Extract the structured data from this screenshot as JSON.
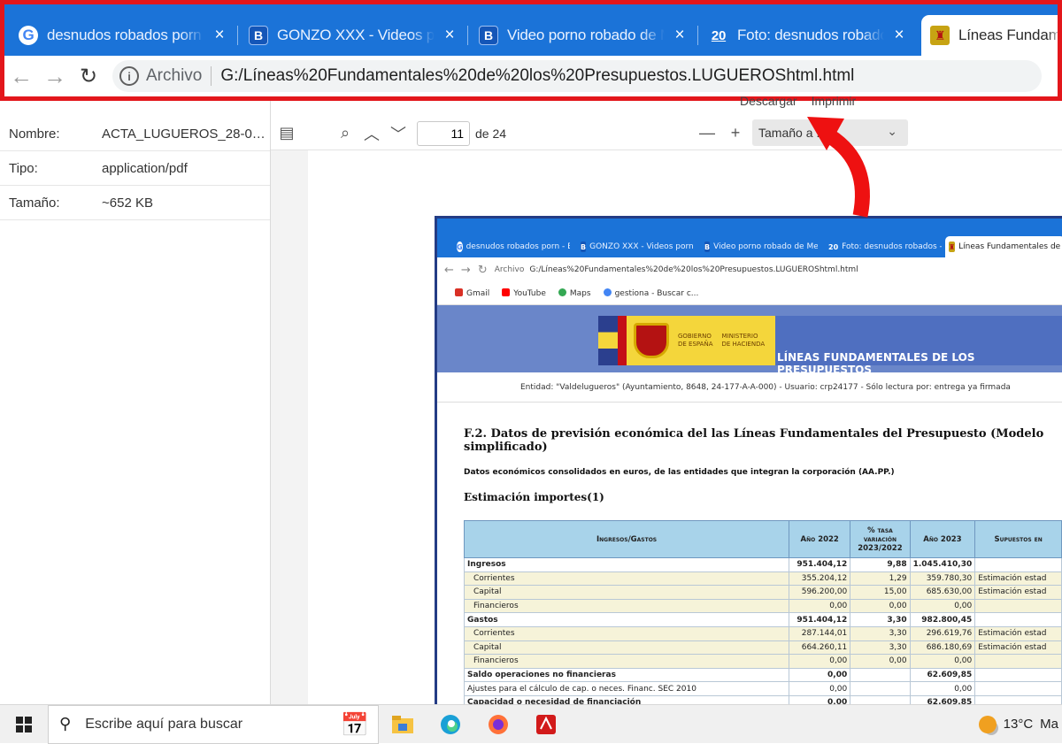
{
  "browser": {
    "tabs": [
      {
        "title": "desnudos robados porn - Bú",
        "icon": "google-icon"
      },
      {
        "title": "GONZO XXX - Videos porno",
        "icon": "b-site-icon"
      },
      {
        "title": "Video porno robado de Meg",
        "icon": "b-site-icon"
      },
      {
        "title": "Foto: desnudos robados - el",
        "icon": "20-site-icon"
      },
      {
        "title": "Líneas Fundamentales de los",
        "icon": "spain-gov-icon"
      }
    ],
    "close_glyph": "×",
    "address": {
      "label": "Archivo",
      "url": "G:/Líneas%20Fundamentales%20de%20los%20Presupuestos.LUGUEROShtml.html"
    },
    "outline_color": "#e3161b"
  },
  "side_panel": {
    "rows": [
      {
        "key": "Nombre:",
        "value": "ACTA_LUGUEROS_28-09-..."
      },
      {
        "key": "Tipo:",
        "value": "application/pdf"
      },
      {
        "key": "Tamaño:",
        "value": "~652 KB"
      }
    ]
  },
  "actions": {
    "download": "Descargar",
    "print": "Imprimir"
  },
  "pdf_toolbar": {
    "page": "11",
    "of_pages": "de 24",
    "zoom": "Tamaño a  ...  o"
  },
  "embedded": {
    "tabs": [
      "desnudos robados porn - Bú",
      "GONZO XXX - Videos porno",
      "Video porno robado de Meg",
      "Foto: desnudos robados - el",
      "Líneas Fundamentales de los"
    ],
    "url_label": "Archivo",
    "url": "G:/Líneas%20Fundamentales%20de%20los%20Presupuestos.LUGUEROShtml.html",
    "bookmarks": [
      "Gmail",
      "YouTube",
      "Maps",
      "gestiona - Buscar c..."
    ],
    "gov_text": "GOBIERNO\nDE ESPAÑA",
    "ministry_text": "MINISTERIO\nDE HACIENDA",
    "banner_title": "LÍNEAS FUNDAMENTALES DE LOS PRESUPUESTOS",
    "entidad": "Entidad: \"Valdelugueros\" (Ayuntamiento, 8648, 24-177-A-A-000) - Usuario: crp24177 - Sólo lectura por: entrega ya firmada",
    "heading": "F.2. Datos de previsión económica del las Líneas Fundamentales del Presupuesto (Modelo simplificado)",
    "subheading": "Datos económicos consolidados en euros, de las entidades que integran la corporación (AA.PP.)",
    "section": "Estimación importes(1)",
    "table": {
      "headers": [
        "Ingresos/Gastos",
        "Año 2022",
        "% tasa variación 2023/2022",
        "Año 2023",
        "Supuestos en"
      ],
      "rows": [
        {
          "type": "main",
          "cells": [
            "Ingresos",
            "951.404,12",
            "9,88",
            "1.045.410,30",
            ""
          ]
        },
        {
          "type": "sub",
          "cells": [
            "Corrientes",
            "355.204,12",
            "1,29",
            "359.780,30",
            "Estimación estad"
          ]
        },
        {
          "type": "sub",
          "cells": [
            "Capital",
            "596.200,00",
            "15,00",
            "685.630,00",
            "Estimación estad"
          ]
        },
        {
          "type": "sub",
          "cells": [
            "Financieros",
            "0,00",
            "0,00",
            "0,00",
            ""
          ]
        },
        {
          "type": "main",
          "cells": [
            "Gastos",
            "951.404,12",
            "3,30",
            "982.800,45",
            ""
          ]
        },
        {
          "type": "sub",
          "cells": [
            "Corrientes",
            "287.144,01",
            "3,30",
            "296.619,76",
            "Estimación estad"
          ]
        },
        {
          "type": "sub",
          "cells": [
            "Capital",
            "664.260,11",
            "3,30",
            "686.180,69",
            "Estimación estad"
          ]
        },
        {
          "type": "sub",
          "cells": [
            "Financieros",
            "0,00",
            "0,00",
            "0,00",
            ""
          ]
        },
        {
          "type": "main",
          "cells": [
            "Saldo operaciones no financieras",
            "0,00",
            "",
            "62.609,85",
            ""
          ]
        },
        {
          "type": "plain",
          "cells": [
            "Ajustes para el cálculo de cap. o neces. Financ. SEC 2010",
            "0,00",
            "",
            "0,00",
            ""
          ]
        },
        {
          "type": "main",
          "cells": [
            "Capacidad o necesidad de financiación",
            "0,00",
            "",
            "62.609,85",
            ""
          ]
        }
      ]
    }
  },
  "taskbar": {
    "search_placeholder": "Escribe aquí para buscar",
    "apps": [
      "file-explorer-icon",
      "edge-icon",
      "firefox-icon",
      "acrobat-icon"
    ],
    "temperature": "13°C",
    "weather_text": "Ma"
  }
}
